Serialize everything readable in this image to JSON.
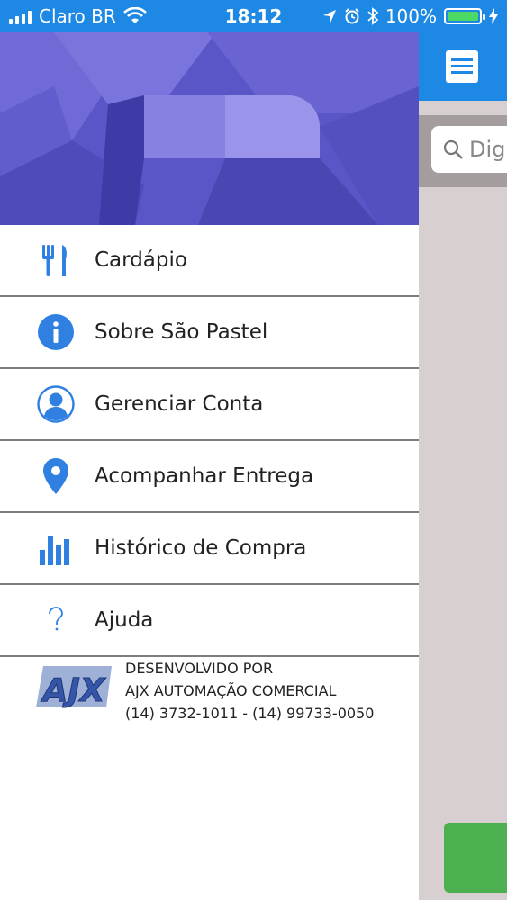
{
  "status_bar": {
    "carrier": "Claro BR",
    "time": "18:12",
    "battery": "100%"
  },
  "drawer": {
    "menu": [
      {
        "label": "Cardápio",
        "icon": "cutlery-icon"
      },
      {
        "label": "Sobre São Pastel",
        "icon": "info-icon"
      },
      {
        "label": "Gerenciar Conta",
        "icon": "user-icon"
      },
      {
        "label": "Acompanhar Entrega",
        "icon": "location-pin-icon"
      },
      {
        "label": "Histórico de Compra",
        "icon": "bar-chart-icon"
      },
      {
        "label": "Ajuda",
        "icon": "question-icon"
      }
    ],
    "footer": {
      "logo_text": "AJX",
      "line1": "DESENVOLVIDO POR",
      "line2": "AJX AUTOMAÇÃO COMERCIAL",
      "line3": "(14) 3732-1011 - (14) 99733-0050"
    }
  },
  "background_app": {
    "search_placeholder": "Dig"
  },
  "colors": {
    "primary": "#1e88e5",
    "icon_blue": "#2f80e0",
    "banner_purple": "#5a56c8",
    "overlay_gray": "#d8d0d0",
    "button_green": "#4caf50"
  }
}
